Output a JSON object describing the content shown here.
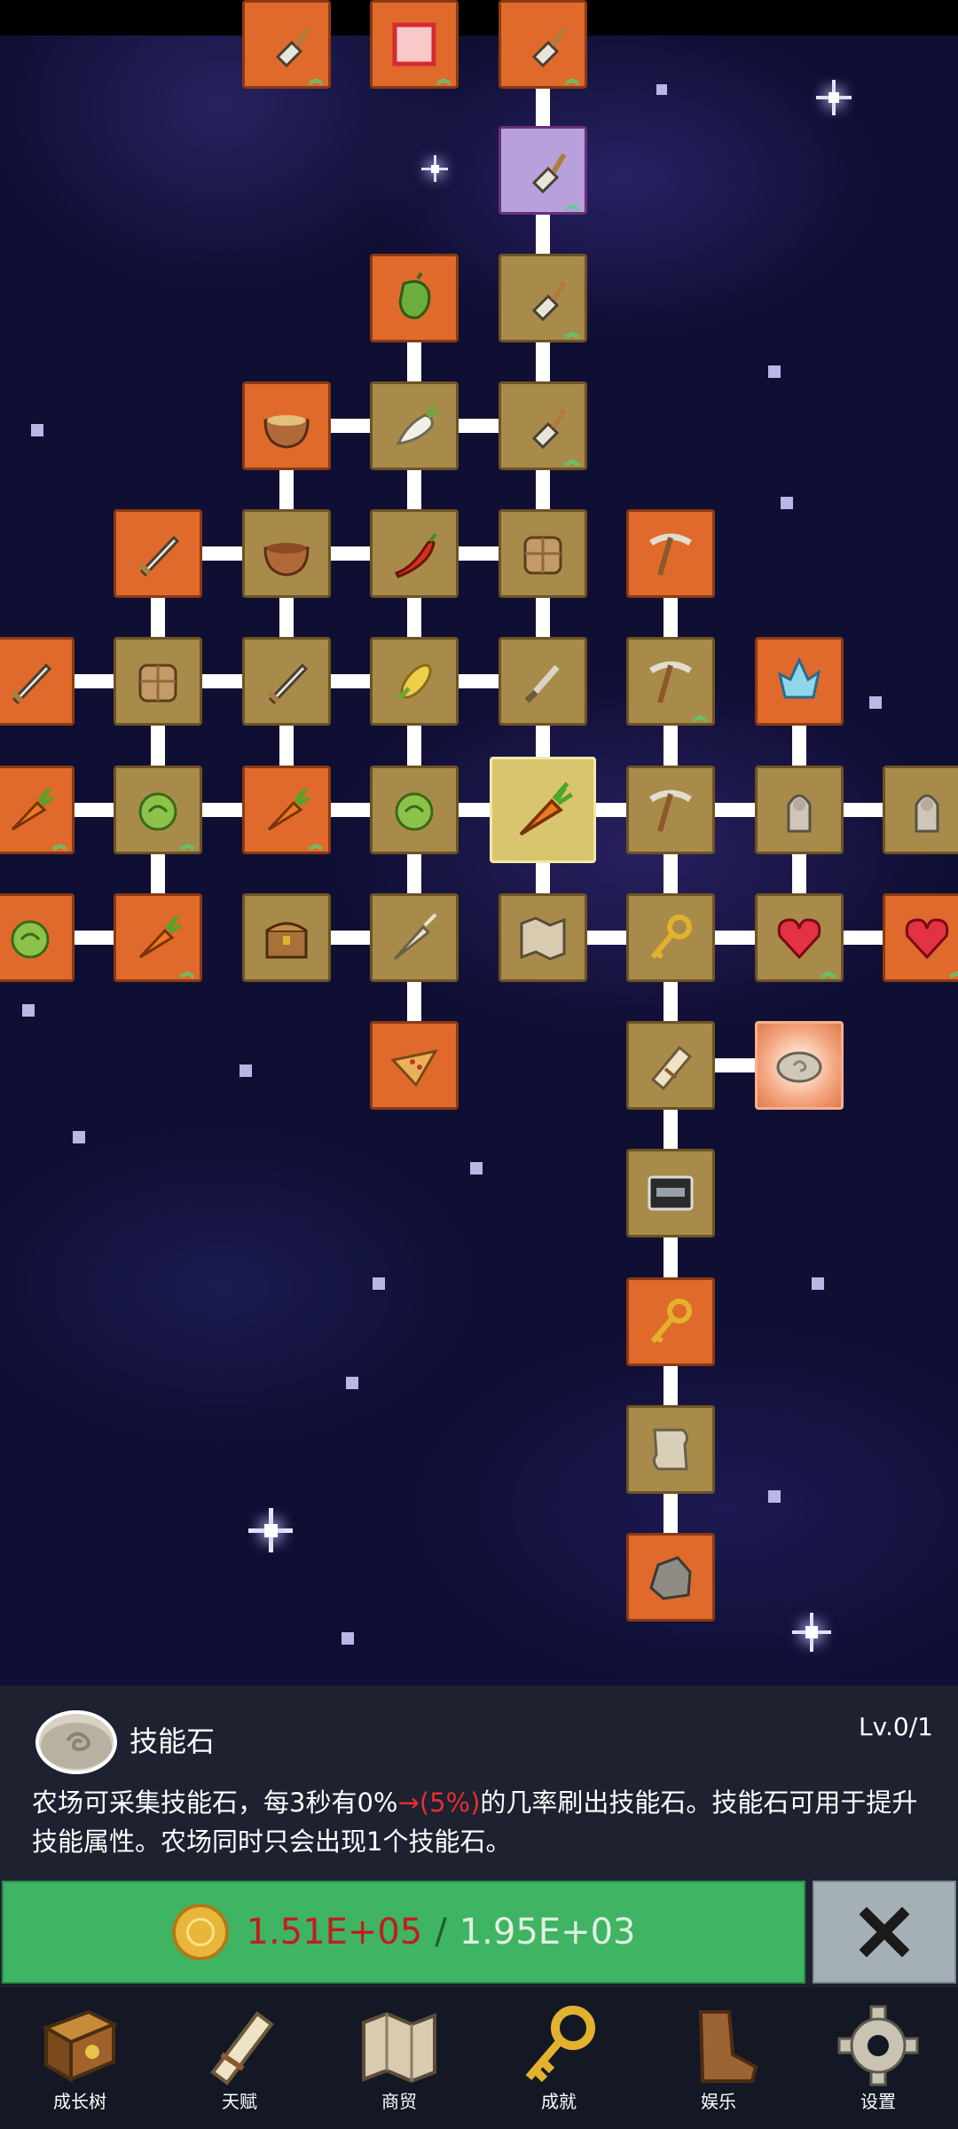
{
  "skill": {
    "name": "技能石",
    "level": "Lv.0/1",
    "desc_part1": "农场可采集技能石，每3秒有0%",
    "desc_arrow": "→",
    "desc_highlight": "(5%)",
    "desc_part2": "的几率刷出技能石。技能石可用于提升技能属性。农场同时只会出现1个技能石。",
    "icon": "skill-stone-icon"
  },
  "upgrade": {
    "current": "1.51E+05",
    "separator": "/",
    "required": "1.95E+03",
    "icon": "gold-coin-icon"
  },
  "close": {
    "icon": "close-x-icon"
  },
  "nav": {
    "items": [
      {
        "label": "成长树",
        "icon": "book-icon"
      },
      {
        "label": "天赋",
        "icon": "scroll-icon"
      },
      {
        "label": "商贸",
        "icon": "map-icon"
      },
      {
        "label": "成就",
        "icon": "key-icon"
      },
      {
        "label": "娱乐",
        "icon": "boot-icon"
      },
      {
        "label": "设置",
        "icon": "gear-icon"
      }
    ]
  },
  "tree_nodes": [
    {
      "id": "shovel-top-1",
      "icon": "shovel-icon",
      "style": "orange",
      "upgrade": true
    },
    {
      "id": "card-top",
      "icon": "card-icon",
      "style": "orange",
      "upgrade": true
    },
    {
      "id": "shovel-top-2",
      "icon": "shovel-icon",
      "style": "orange",
      "upgrade": true
    },
    {
      "id": "shovel-purple",
      "icon": "shovel-icon",
      "style": "purple",
      "upgrade": true
    },
    {
      "id": "pepper",
      "icon": "pepper-icon",
      "style": "orange",
      "upgrade": false
    },
    {
      "id": "shovel-2",
      "icon": "shovel-icon",
      "style": "tan",
      "upgrade": true
    },
    {
      "id": "soup-bowl",
      "icon": "soup-bowl-icon",
      "style": "orange",
      "upgrade": false
    },
    {
      "id": "radish",
      "icon": "radish-icon",
      "style": "tan",
      "upgrade": false
    },
    {
      "id": "shovel-3",
      "icon": "shovel-icon",
      "style": "tan",
      "upgrade": true
    },
    {
      "id": "sword-gold",
      "icon": "sword-icon",
      "style": "orange",
      "upgrade": false
    },
    {
      "id": "bowl",
      "icon": "bowl-icon",
      "style": "tan",
      "upgrade": false
    },
    {
      "id": "chili",
      "icon": "chili-icon",
      "style": "tan",
      "upgrade": false
    },
    {
      "id": "backpack",
      "icon": "backpack-icon",
      "style": "tan",
      "upgrade": false
    },
    {
      "id": "pickaxe-gold",
      "icon": "pickaxe-icon",
      "style": "orange",
      "upgrade": false
    },
    {
      "id": "edge-left-1",
      "icon": "sword-icon",
      "style": "orange",
      "upgrade": false
    },
    {
      "id": "backpack-2",
      "icon": "backpack-icon",
      "style": "tan",
      "upgrade": false
    },
    {
      "id": "sword",
      "icon": "sword-icon",
      "style": "tan",
      "upgrade": false
    },
    {
      "id": "corn",
      "icon": "corn-icon",
      "style": "tan",
      "upgrade": false
    },
    {
      "id": "dagger",
      "icon": "dagger-icon",
      "style": "tan",
      "upgrade": false
    },
    {
      "id": "pickaxe-2",
      "icon": "pickaxe-icon",
      "style": "tan",
      "upgrade": true
    },
    {
      "id": "crystal",
      "icon": "crystal-icon",
      "style": "orange",
      "upgrade": false
    },
    {
      "id": "edge-left-2",
      "icon": "carrot-icon",
      "style": "orange",
      "upgrade": true
    },
    {
      "id": "cabbage",
      "icon": "cabbage-icon",
      "style": "tan",
      "upgrade": true
    },
    {
      "id": "carrot-card",
      "icon": "carrot-icon",
      "style": "orange",
      "upgrade": true
    },
    {
      "id": "cabbage-2",
      "icon": "cabbage-icon",
      "style": "tan",
      "upgrade": false
    },
    {
      "id": "carrot-selected",
      "icon": "carrot-icon",
      "style": "selected",
      "upgrade": false
    },
    {
      "id": "pickaxe-3",
      "icon": "pickaxe-icon",
      "style": "tan",
      "upgrade": false
    },
    {
      "id": "statue",
      "icon": "statue-icon",
      "style": "tan",
      "upgrade": false
    },
    {
      "id": "statue-2",
      "icon": "statue-icon",
      "style": "tan",
      "upgrade": false
    },
    {
      "id": "edge-left-3",
      "icon": "cabbage-icon",
      "style": "orange",
      "upgrade": false
    },
    {
      "id": "carrot-card-2",
      "icon": "carrot-icon",
      "style": "orange",
      "upgrade": true
    },
    {
      "id": "chest",
      "icon": "chest-icon",
      "style": "tan",
      "upgrade": false
    },
    {
      "id": "parsnip",
      "icon": "parsnip-icon",
      "style": "tan",
      "upgrade": false
    },
    {
      "id": "map",
      "icon": "map-icon",
      "style": "tan",
      "upgrade": false
    },
    {
      "id": "key-gold",
      "icon": "key-icon",
      "style": "tan",
      "upgrade": false
    },
    {
      "id": "heart",
      "icon": "heart-icon",
      "style": "tan",
      "upgrade": true
    },
    {
      "id": "heart-2",
      "icon": "heart-icon",
      "style": "orange",
      "upgrade": true
    },
    {
      "id": "pizza",
      "icon": "pizza-icon",
      "style": "orange",
      "upgrade": false
    },
    {
      "id": "scroll",
      "icon": "scroll-icon",
      "style": "tan",
      "upgrade": false
    },
    {
      "id": "skill-stone",
      "icon": "skill-stone-icon",
      "style": "glow",
      "upgrade": false
    },
    {
      "id": "tape",
      "icon": "tape-icon",
      "style": "tan",
      "upgrade": false
    },
    {
      "id": "key-rust",
      "icon": "key-icon",
      "style": "orange",
      "upgrade": false
    },
    {
      "id": "paper",
      "icon": "paper-icon",
      "style": "tan",
      "upgrade": false
    },
    {
      "id": "rock",
      "icon": "rock-icon",
      "style": "orange",
      "upgrade": false
    }
  ]
}
